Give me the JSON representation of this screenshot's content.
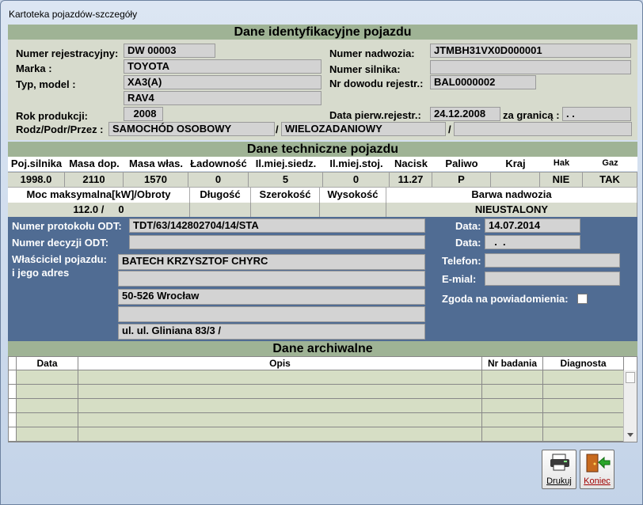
{
  "window": {
    "title": "Kartoteka pojazdów-szczegóły"
  },
  "sections": {
    "ident": "Dane identyfikacyjne pojazdu",
    "tech": "Dane techniczne pojazdu",
    "archive": "Dane archiwalne"
  },
  "ident": {
    "labels": {
      "nr_rej": "Numer rejestracyjny:",
      "marka": "Marka :",
      "typ": "Typ, model :",
      "rok": "Rok produkcji:",
      "rodz": "Rodz/Podr/Przez :",
      "nadwozie": "Numer nadwozia:",
      "silnik": "Numer silnika:",
      "dowod": "Nr dowodu rejestr.:",
      "data_pierw": "Data pierw.rejestr.:",
      "za_granica": "za granicą :",
      "sep1": "/",
      "sep2": "/"
    },
    "values": {
      "nr_rej": "DW 00003",
      "marka": "TOYOTA",
      "typ": "XA3(A)",
      "model": "RAV4",
      "rok": "2008",
      "rodzaj": "SAMOCHÓD OSOBOWY",
      "podrodzaj": "WIELOZADANIOWY",
      "przeznaczenie": "",
      "nadwozie": "JTMBH31VX0D000001",
      "silnik": "",
      "dowod": "BAL0000002",
      "data_pierw": "24.12.2008",
      "za_granica": "  .  ."
    }
  },
  "tech": {
    "headers": [
      "Poj.silnika",
      "Masa dop.",
      "Masa włas.",
      "Ładowność",
      "Il.miej.siedz.",
      "Il.miej.stoj.",
      "Nacisk",
      "Paliwo",
      "Kraj",
      "Hak",
      "Gaz"
    ],
    "values": [
      "1998.0",
      "2110",
      "1570",
      "0",
      "5",
      "0",
      "11.27",
      "P",
      "",
      "NIE",
      "TAK"
    ],
    "headers2": [
      "Moc maksymalna[kW]/Obroty",
      "Długość",
      "Szerokość",
      "Wysokość",
      "Barwa nadwozia"
    ],
    "values2": [
      "112.0 /     0",
      "",
      "",
      "",
      "NIEUSTALONY"
    ]
  },
  "odt": {
    "labels": {
      "protokol": "Numer protokołu ODT:",
      "decyzja": "Numer decyzji ODT:",
      "wlasciciel1": "Właściciel pojazdu:",
      "wlasciciel2": "i jego adres",
      "data1": "Data:",
      "data2": "Data:",
      "telefon": "Telefon:",
      "email": "E-mial:",
      "zgoda": "Zgoda na powiadomienia:"
    },
    "values": {
      "protokol": "TDT/63/142802704/14/STA",
      "decyzja": "",
      "owner_line1": "BATECH KRZYSZTOF CHYRC",
      "owner_line2": "",
      "owner_line3": "50-526 Wrocław",
      "owner_line4": "",
      "owner_line5": "ul. ul. Gliniana 83/3 /",
      "data1": "14.07.2014",
      "data2": "  .  .",
      "telefon": "",
      "email": ""
    }
  },
  "archive": {
    "headers": [
      "Data",
      "Opis",
      "Nr badania",
      "Diagnosta"
    ],
    "rows": 5
  },
  "buttons": {
    "print": "Drukuj",
    "close": "Koniec"
  },
  "colors": {
    "section_band": "#9fb395",
    "owner_panel": "#506c93",
    "field_bg": "#d3d3d3"
  }
}
